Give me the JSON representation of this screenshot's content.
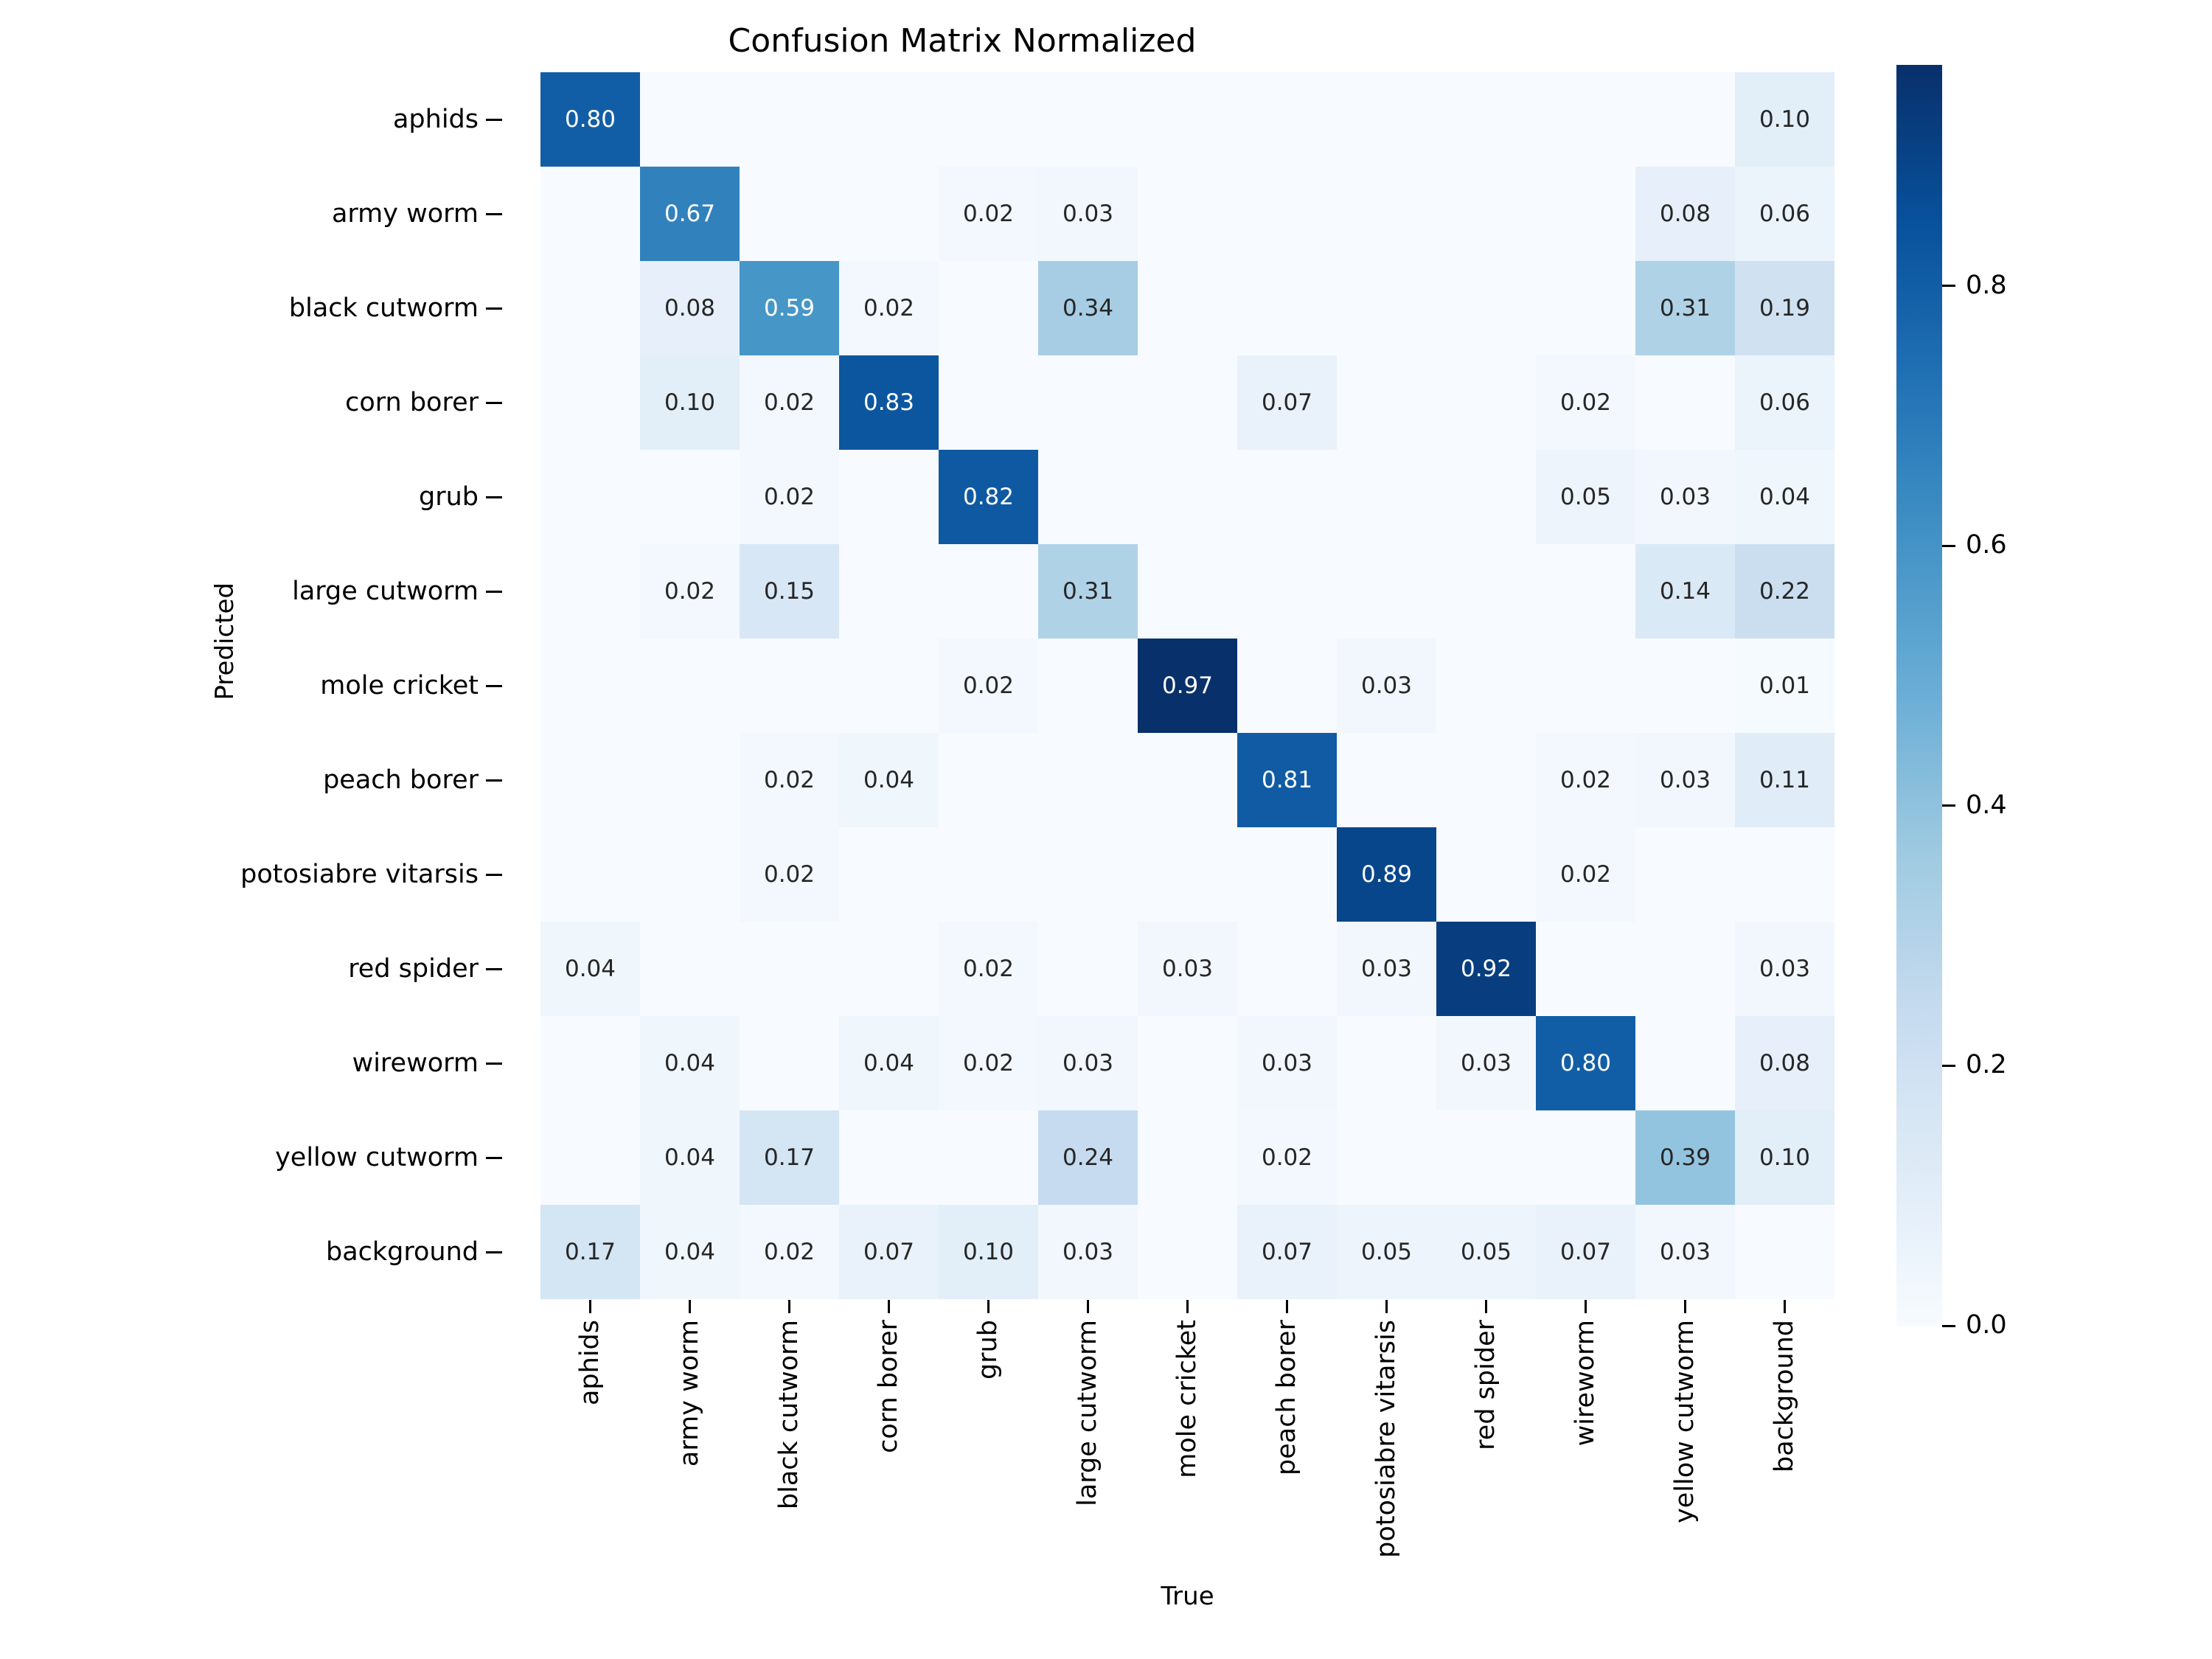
{
  "chart_data": {
    "type": "heatmap",
    "title": "Confusion Matrix Normalized",
    "xlabel": "True",
    "ylabel": "Predicted",
    "colormap": "Blues",
    "vmin": 0.0,
    "vmax": 0.97,
    "colorbar": {
      "ticks": [
        0.0,
        0.2,
        0.4,
        0.6,
        0.8
      ],
      "tick_labels": [
        "0.0",
        "0.2",
        "0.4",
        "0.6",
        "0.8"
      ],
      "position": "right",
      "low_color": "#f7fbff",
      "high_color": "#08306b"
    },
    "grid": false,
    "categories": [
      "aphids",
      "army worm",
      "black cutworm",
      "corn borer",
      "grub",
      "large cutworm",
      "mole cricket",
      "peach borer",
      "potosiabre vitarsis",
      "red spider",
      "wireworm",
      "yellow cutworm",
      "background"
    ],
    "x_categories": [
      "aphids",
      "army worm",
      "black cutworm",
      "corn borer",
      "grub",
      "large cutworm",
      "mole cricket",
      "peach borer",
      "potosiabre vitarsis",
      "red spider",
      "wireworm",
      "yellow cutworm",
      "background"
    ],
    "y_categories": [
      "aphids",
      "army worm",
      "black cutworm",
      "corn borer",
      "grub",
      "large cutworm",
      "mole cricket",
      "peach borer",
      "potosiabre vitarsis",
      "red spider",
      "wireworm",
      "yellow cutworm",
      "background"
    ],
    "matrix": [
      [
        0.8,
        null,
        null,
        null,
        null,
        null,
        null,
        null,
        null,
        null,
        null,
        null,
        0.1
      ],
      [
        null,
        0.67,
        null,
        null,
        0.02,
        0.03,
        null,
        null,
        null,
        null,
        null,
        0.08,
        0.06
      ],
      [
        null,
        0.08,
        0.59,
        0.02,
        null,
        0.34,
        null,
        null,
        null,
        null,
        null,
        0.31,
        0.19
      ],
      [
        null,
        0.1,
        0.02,
        0.83,
        null,
        null,
        null,
        0.07,
        null,
        null,
        0.02,
        null,
        0.06
      ],
      [
        null,
        null,
        0.02,
        null,
        0.82,
        null,
        null,
        null,
        null,
        null,
        0.05,
        0.03,
        0.04
      ],
      [
        null,
        0.02,
        0.15,
        null,
        null,
        0.31,
        null,
        null,
        null,
        null,
        null,
        0.14,
        0.22
      ],
      [
        null,
        null,
        null,
        null,
        0.02,
        null,
        0.97,
        null,
        0.03,
        null,
        null,
        null,
        0.01
      ],
      [
        null,
        null,
        0.02,
        0.04,
        null,
        null,
        null,
        0.81,
        null,
        null,
        0.02,
        0.03,
        0.11
      ],
      [
        null,
        null,
        0.02,
        null,
        null,
        null,
        null,
        null,
        0.89,
        null,
        0.02,
        null,
        null
      ],
      [
        0.04,
        null,
        null,
        null,
        0.02,
        null,
        0.03,
        null,
        0.03,
        0.92,
        null,
        null,
        0.03
      ],
      [
        null,
        0.04,
        null,
        0.04,
        0.02,
        0.03,
        null,
        0.03,
        null,
        0.03,
        0.8,
        null,
        0.08
      ],
      [
        null,
        0.04,
        0.17,
        null,
        null,
        0.24,
        null,
        0.02,
        null,
        null,
        null,
        0.39,
        0.1
      ],
      [
        0.17,
        0.04,
        0.02,
        0.07,
        0.1,
        0.03,
        null,
        0.07,
        0.05,
        0.05,
        0.07,
        0.03,
        null
      ]
    ]
  }
}
